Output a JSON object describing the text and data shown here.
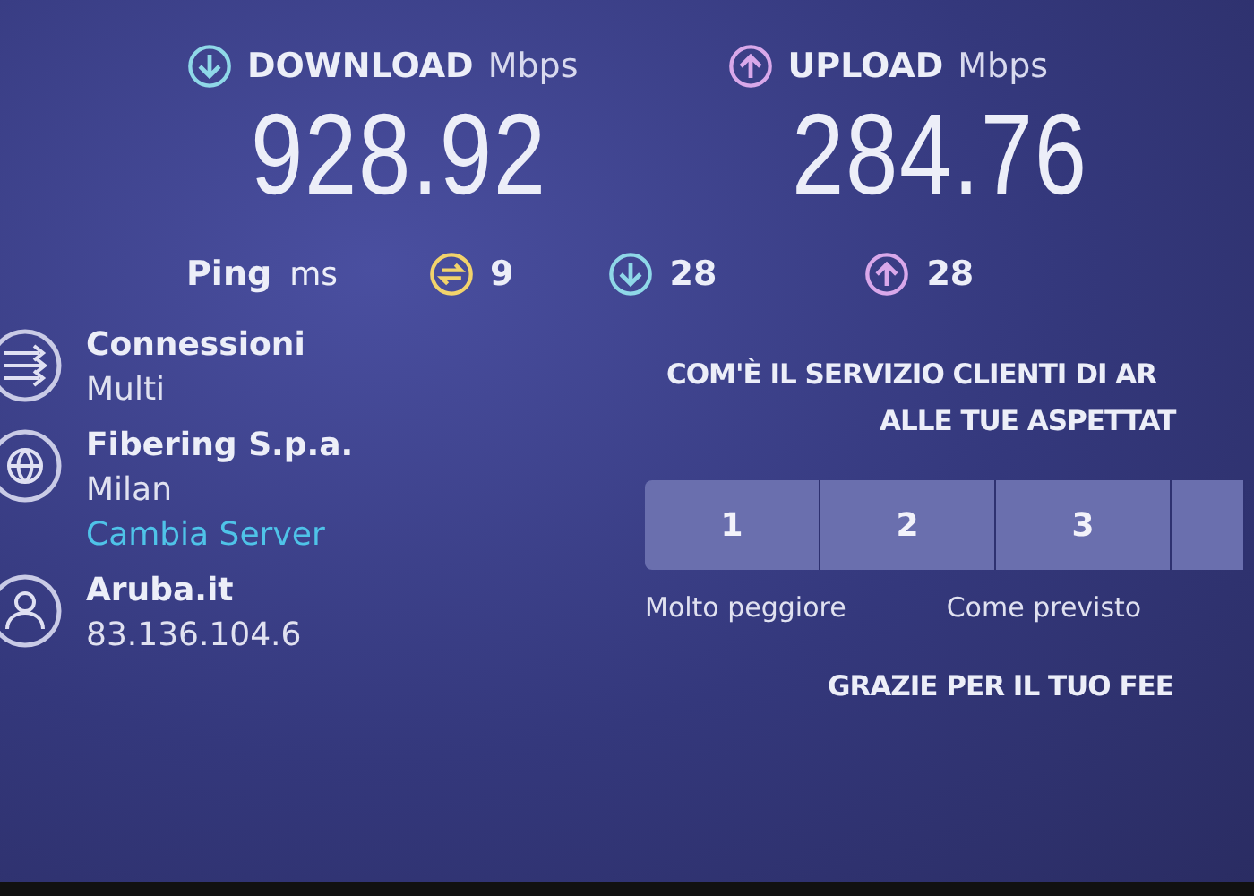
{
  "download": {
    "label": "DOWNLOAD",
    "unit": "Mbps",
    "value": "928.92"
  },
  "upload": {
    "label": "UPLOAD",
    "unit": "Mbps",
    "value": "284.76"
  },
  "ping": {
    "label": "Ping",
    "unit": "ms",
    "values": [
      {
        "kind": "idle",
        "value": "9"
      },
      {
        "kind": "down",
        "value": "28"
      },
      {
        "kind": "up",
        "value": "28"
      }
    ]
  },
  "info": [
    {
      "kind": "connections",
      "title": "Connessioni",
      "lines": [
        "Multi"
      ]
    },
    {
      "kind": "server",
      "title": "Fibering S.p.a.",
      "lines": [
        "Milan"
      ],
      "link": "Cambia Server"
    },
    {
      "kind": "provider",
      "title": "Aruba.it",
      "lines": [
        "83.136.104.6"
      ]
    }
  ],
  "survey": {
    "question": [
      "COM'È IL SERVIZIO CLIENTI DI AR",
      "ALLE TUE ASPETTAT"
    ],
    "ratings": [
      "1",
      "2",
      "3"
    ],
    "scale_labels": [
      "Molto peggiore",
      "Come previsto"
    ],
    "thanks": "GRAZIE PER IL TUO FEE"
  }
}
